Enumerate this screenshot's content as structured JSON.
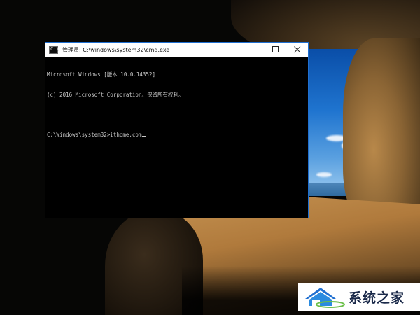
{
  "window": {
    "title": "管理员: C:\\windows\\system32\\cmd.exe",
    "icon": "cmd-icon",
    "controls": [
      "minimize-icon",
      "maximize-icon",
      "close-icon"
    ]
  },
  "console": {
    "lines": [
      "Microsoft Windows [版本 10.0.14352]",
      "(c) 2016 Microsoft Corporation。保留所有权利。",
      "",
      "C:\\Windows\\system32>ithome.com"
    ]
  },
  "watermark": {
    "text": "系统之家"
  },
  "colors": {
    "window_border": "#1f6fd1",
    "console_bg": "#000000",
    "console_text": "#c8c8c8",
    "title_bar_bg": "#ffffff"
  }
}
